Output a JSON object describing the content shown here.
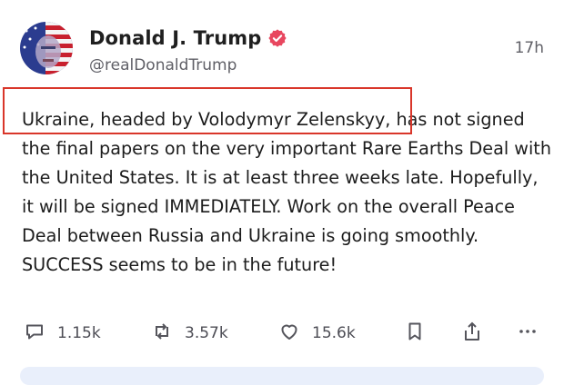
{
  "post": {
    "author_name": "Donald J. Trump",
    "handle": "@realDonaldTrump",
    "time": "17h",
    "text": "Ukraine, headed by Volodymyr Zelenskyy, has not signed the final papers on the very important Rare Earths Deal with the United States. It is at least three weeks late. Hopefully, it will be signed IMMEDIATELY. Work on the overall Peace Deal between Russia and Ukraine is going smoothly. SUCCESS seems to be in the future!"
  },
  "actions": {
    "replies": "1.15k",
    "reposts": "3.57k",
    "likes": "15.6k"
  },
  "icons": {
    "verified": "verified-badge-icon",
    "reply": "reply-icon",
    "repost": "repost-icon",
    "like": "heart-icon",
    "bookmark": "bookmark-icon",
    "share": "share-icon",
    "more": "more-icon"
  },
  "colors": {
    "verified_badge": "#e8475f",
    "highlight_box": "#d9362a",
    "muted_text": "#5f5f66"
  }
}
